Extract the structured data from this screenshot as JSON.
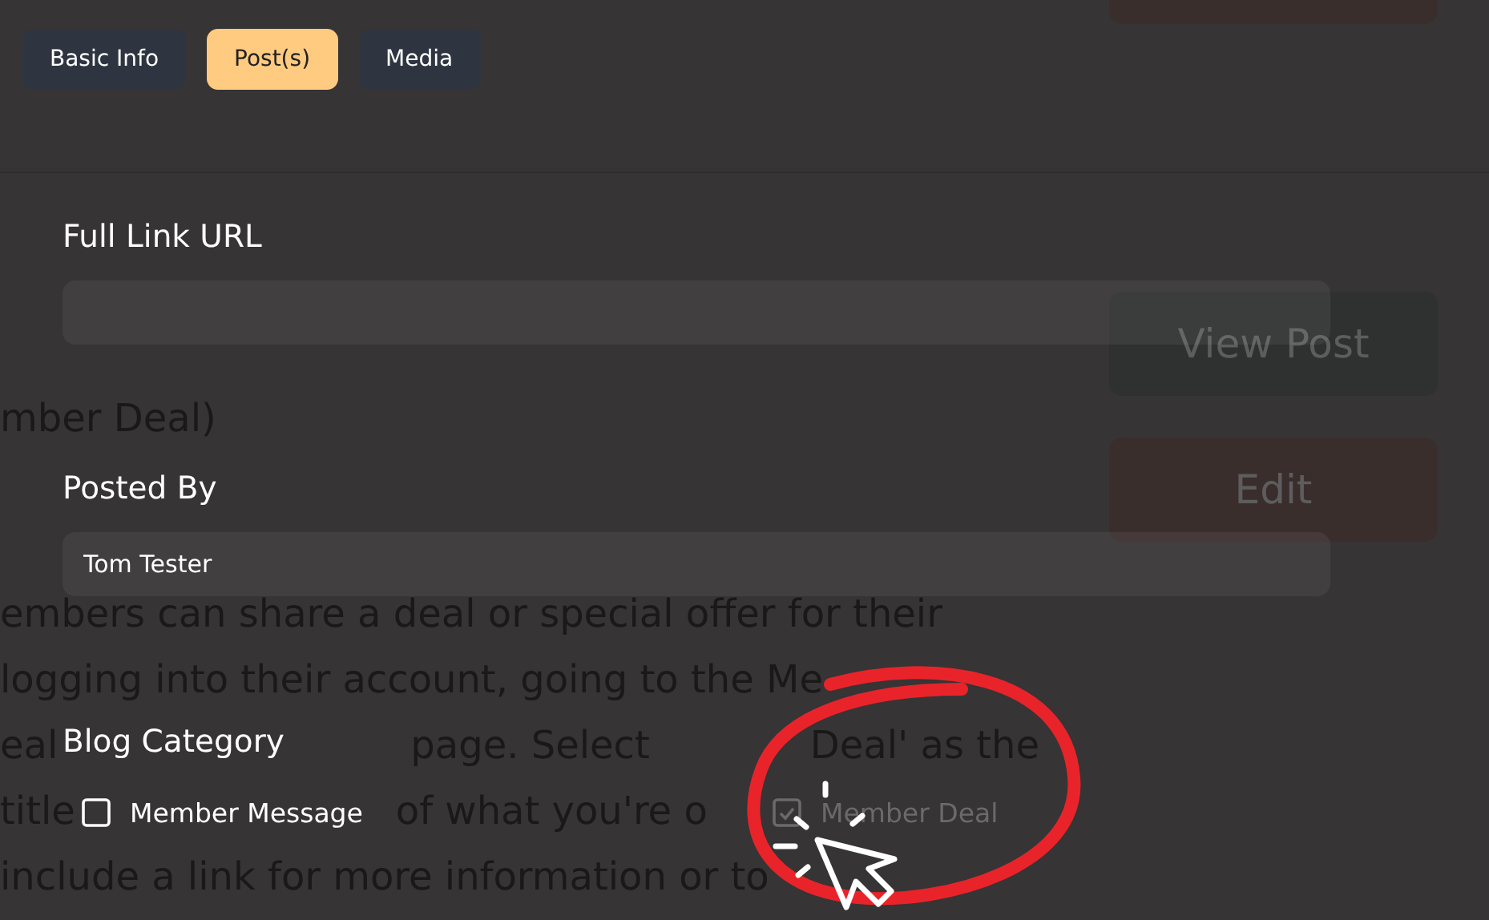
{
  "background_page": {
    "text_lines": [
      {
        "segments": [
          "mber Deal)"
        ]
      },
      {
        "segments": [
          "embers can share a deal or special offer for their"
        ]
      },
      {
        "segments": [
          "logging into their account, going to the Me"
        ]
      },
      {
        "segments": [
          "eal",
          "page. Select",
          "Deal' as the"
        ]
      },
      {
        "segments": [
          "title",
          "of what you're o"
        ]
      },
      {
        "segments": [
          "include a link for more information or to"
        ]
      }
    ],
    "buttons": [
      {
        "kind": "edit"
      },
      {
        "label": "View Post",
        "kind": "view"
      },
      {
        "label": "Edit",
        "kind": "edit"
      }
    ]
  },
  "tabs": [
    {
      "label": "Basic Info",
      "selected": false
    },
    {
      "label": "Post(s)",
      "selected": true
    },
    {
      "label": "Media",
      "selected": false
    }
  ],
  "form": {
    "fields": [
      {
        "label": "Full Link URL"
      },
      {
        "label": "Posted By",
        "value": "Tom Tester"
      }
    ],
    "blog_category": {
      "label": "Blog Category",
      "options": [
        {
          "label": "Member Message",
          "checked": false,
          "disabled": false
        },
        {
          "label": "Member Deal",
          "checked": true,
          "disabled": true
        }
      ]
    }
  }
}
